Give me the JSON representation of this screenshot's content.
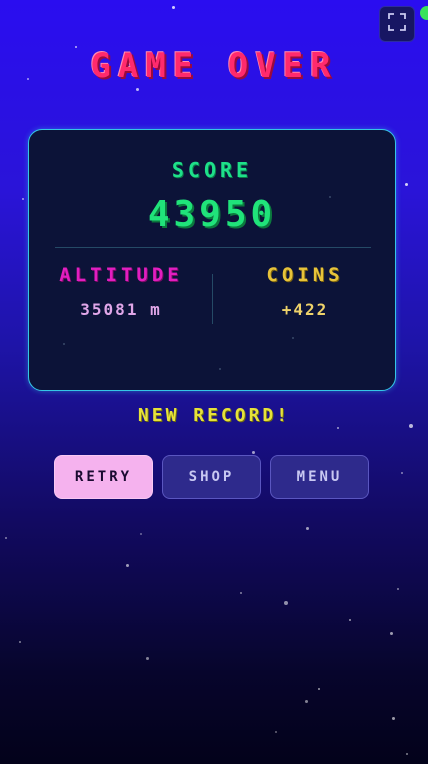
{
  "title": "GAME OVER",
  "fullscreen": {
    "icon": "expand-icon"
  },
  "score": {
    "label": "SCORE",
    "value": "43950"
  },
  "altitude": {
    "label": "ALTITUDE",
    "value": "35081 m"
  },
  "coins": {
    "label": "COINS",
    "value": "+422"
  },
  "record_message": "NEW RECORD!",
  "buttons": {
    "retry": "RETRY",
    "shop": "SHOP",
    "menu": "MENU"
  },
  "colors": {
    "title": "#ff2a6d",
    "score": "#20e37a",
    "altitude": "#e21ec0",
    "coins": "#e7c33a",
    "record": "#e6e23a",
    "panel_border": "#35c6e6",
    "retry_button": "#f5b2ee"
  }
}
